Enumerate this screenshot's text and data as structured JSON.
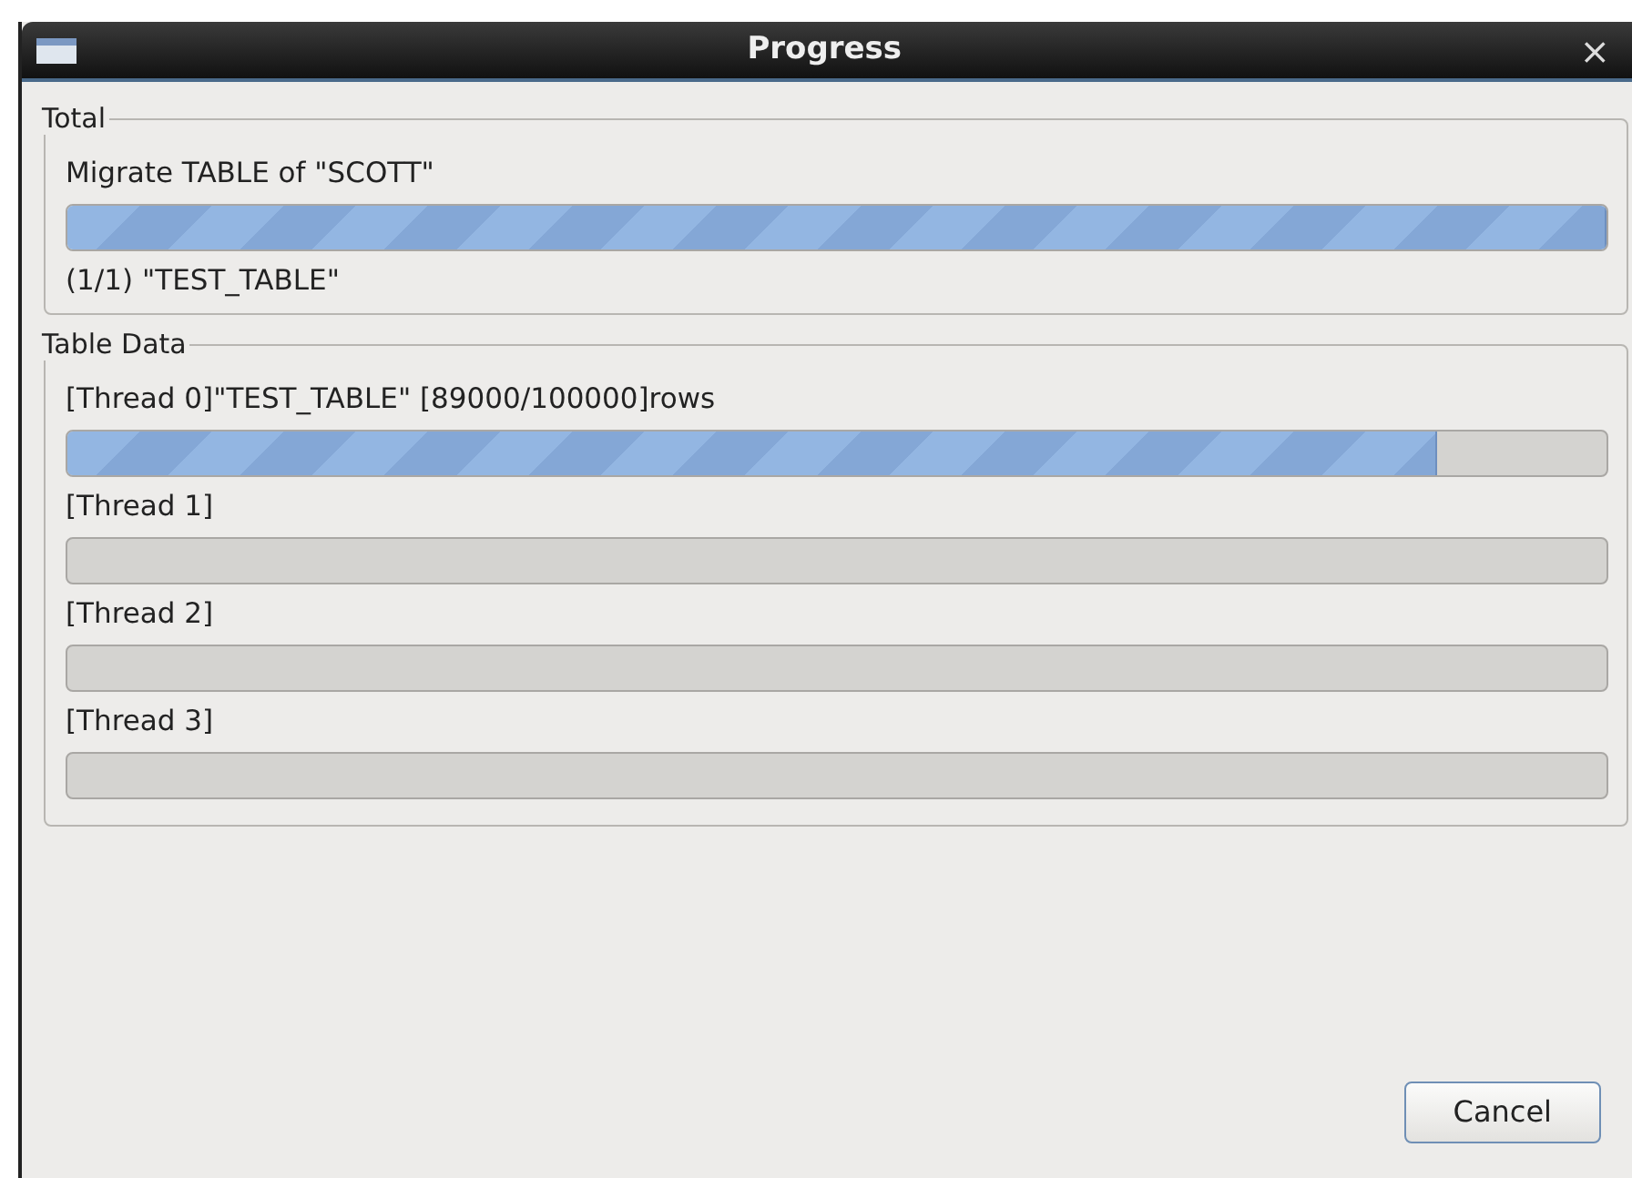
{
  "window": {
    "title": "Progress",
    "close": "×"
  },
  "total": {
    "legend": "Total",
    "label": "Migrate TABLE of \"SCOTT\"",
    "level": 1,
    "detail": "(1/1) \"TEST_TABLE\""
  },
  "table_data": {
    "legend": "Table Data",
    "threads": [
      {
        "label": "[Thread 0]\"TEST_TABLE\" [89000/100000]rows",
        "level": 0.89
      },
      {
        "label": "[Thread 1]"
      },
      {
        "label": "[Thread 2]"
      },
      {
        "label": "[Thread 3]"
      }
    ]
  },
  "buttons": [
    "Cancel"
  ]
}
